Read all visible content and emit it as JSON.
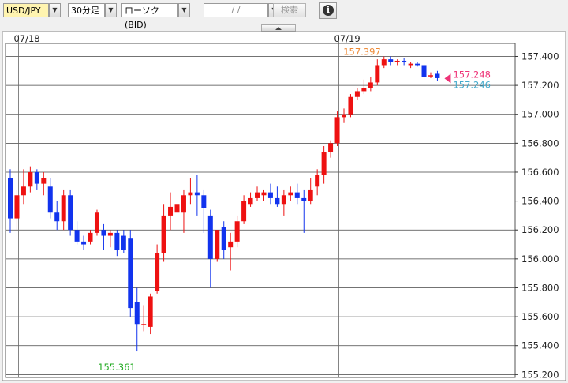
{
  "toolbar": {
    "symbol": "USD/JPY",
    "interval": "30分足",
    "chart_style": "ローソク(BID)",
    "date_placeholder": "/ /",
    "search_label": "検索",
    "info_label": "i"
  },
  "colors": {
    "up": "#ee1111",
    "down": "#1133ee",
    "high_label": "#ee8833",
    "low_label": "#22aa22",
    "ask_marker": "#ee3377",
    "bid_label": "#44aacc",
    "grid": "#444444",
    "plot_bg": "#ffffff"
  },
  "chart_data": {
    "type": "candlestick",
    "date_labels": [
      "07/18",
      "07/19"
    ],
    "date_label_candle_index": [
      1,
      49
    ],
    "ylim": [
      155.18,
      157.49
    ],
    "yticks": [
      "157.400",
      "157.200",
      "157.000",
      "156.800",
      "156.600",
      "156.400",
      "156.200",
      "156.000",
      "155.800",
      "155.600",
      "155.400",
      "155.200"
    ],
    "high_annotation": "157.397",
    "low_annotation": "155.361",
    "last_ask": "157.248",
    "last_bid": "157.246",
    "candles": [
      [
        156.56,
        156.62,
        156.18,
        156.28
      ],
      [
        156.28,
        156.48,
        156.2,
        156.44
      ],
      [
        156.44,
        156.62,
        156.38,
        156.5
      ],
      [
        156.5,
        156.64,
        156.46,
        156.6
      ],
      [
        156.6,
        156.62,
        156.48,
        156.52
      ],
      [
        156.52,
        156.6,
        156.44,
        156.56
      ],
      [
        156.5,
        156.56,
        156.28,
        156.32
      ],
      [
        156.32,
        156.4,
        156.2,
        156.26
      ],
      [
        156.26,
        156.48,
        156.2,
        156.44
      ],
      [
        156.44,
        156.48,
        156.16,
        156.2
      ],
      [
        156.2,
        156.26,
        156.1,
        156.12
      ],
      [
        156.12,
        156.16,
        156.06,
        156.1
      ],
      [
        156.12,
        156.2,
        156.1,
        156.18
      ],
      [
        156.18,
        156.34,
        156.16,
        156.32
      ],
      [
        156.2,
        156.24,
        156.06,
        156.16
      ],
      [
        156.16,
        156.2,
        156.08,
        156.18
      ],
      [
        156.18,
        156.2,
        156.02,
        156.06
      ],
      [
        156.16,
        156.2,
        156.04,
        156.06
      ],
      [
        156.14,
        156.2,
        155.6,
        155.66
      ],
      [
        155.7,
        155.8,
        155.36,
        155.55
      ],
      [
        155.55,
        155.68,
        155.5,
        155.55
      ],
      [
        155.53,
        155.76,
        155.48,
        155.74
      ],
      [
        155.78,
        156.1,
        155.76,
        156.04
      ],
      [
        156.04,
        156.38,
        155.98,
        156.3
      ],
      [
        156.3,
        156.46,
        156.2,
        156.36
      ],
      [
        156.32,
        156.44,
        156.28,
        156.38
      ],
      [
        156.32,
        156.48,
        156.18,
        156.44
      ],
      [
        156.44,
        156.56,
        156.38,
        156.46
      ],
      [
        156.46,
        156.58,
        156.3,
        156.44
      ],
      [
        156.44,
        156.48,
        156.18,
        156.35
      ],
      [
        156.3,
        156.34,
        155.8,
        156.0
      ],
      [
        156.0,
        156.2,
        155.98,
        156.2
      ],
      [
        156.22,
        156.26,
        156.0,
        156.06
      ],
      [
        156.08,
        156.18,
        155.92,
        156.12
      ],
      [
        156.12,
        156.3,
        156.08,
        156.26
      ],
      [
        156.26,
        156.44,
        156.24,
        156.4
      ],
      [
        156.38,
        156.46,
        156.36,
        156.42
      ],
      [
        156.42,
        156.5,
        156.4,
        156.46
      ],
      [
        156.44,
        156.48,
        156.4,
        156.46
      ],
      [
        156.46,
        156.52,
        156.38,
        156.42
      ],
      [
        156.42,
        156.5,
        156.36,
        156.38
      ],
      [
        156.38,
        156.48,
        156.3,
        156.44
      ],
      [
        156.44,
        156.5,
        156.4,
        156.46
      ],
      [
        156.46,
        156.52,
        156.38,
        156.42
      ],
      [
        156.42,
        156.48,
        156.18,
        156.4
      ],
      [
        156.4,
        156.56,
        156.38,
        156.48
      ],
      [
        156.5,
        156.62,
        156.44,
        156.58
      ],
      [
        156.58,
        156.78,
        156.52,
        156.74
      ],
      [
        156.74,
        156.82,
        156.7,
        156.8
      ],
      [
        156.8,
        157.02,
        156.78,
        156.98
      ],
      [
        156.98,
        157.04,
        156.94,
        157.0
      ],
      [
        157.0,
        157.14,
        156.98,
        157.12
      ],
      [
        157.12,
        157.18,
        157.1,
        157.16
      ],
      [
        157.16,
        157.24,
        157.14,
        157.18
      ],
      [
        157.18,
        157.26,
        157.16,
        157.22
      ],
      [
        157.22,
        157.38,
        157.2,
        157.34
      ],
      [
        157.34,
        157.4,
        157.32,
        157.38
      ],
      [
        157.38,
        157.4,
        157.34,
        157.36
      ],
      [
        157.36,
        157.38,
        157.34,
        157.37
      ],
      [
        157.37,
        157.39,
        157.34,
        157.36
      ],
      [
        157.34,
        157.36,
        157.32,
        157.35
      ],
      [
        157.35,
        157.36,
        157.33,
        157.34
      ],
      [
        157.34,
        157.35,
        157.24,
        157.26
      ],
      [
        157.27,
        157.29,
        157.25,
        157.27
      ],
      [
        157.28,
        157.3,
        157.23,
        157.25
      ]
    ]
  }
}
